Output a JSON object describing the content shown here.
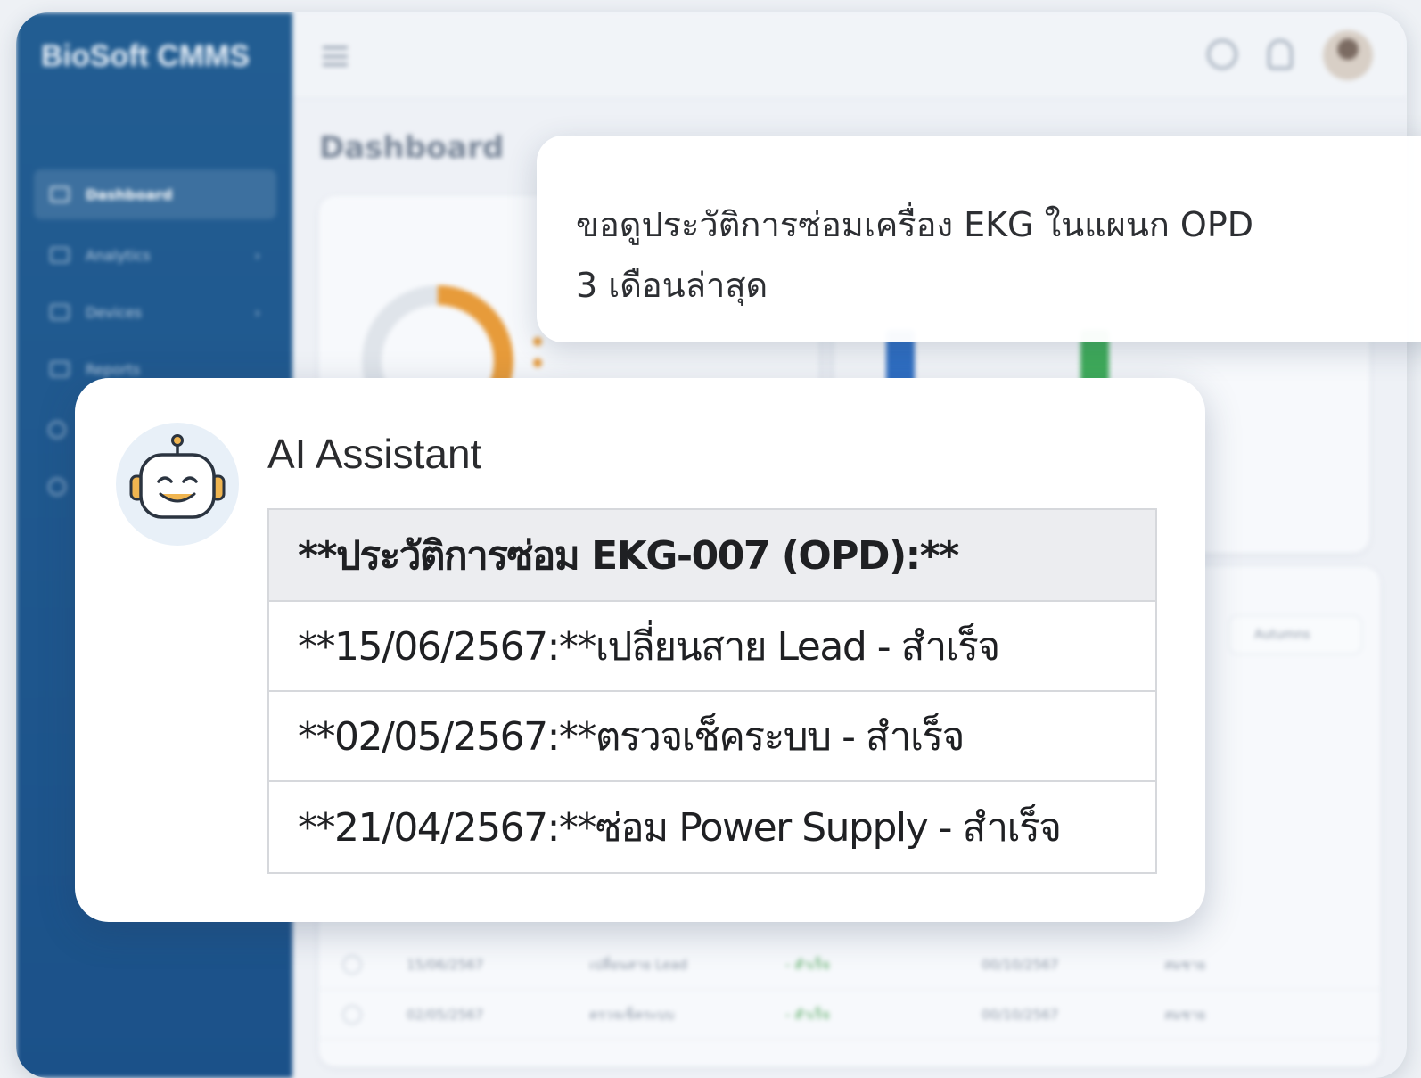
{
  "app": {
    "brand": "BioSoft CMMS",
    "page_title": "Dashboard",
    "sidebar": {
      "items": [
        {
          "label": "Dashboard",
          "active": true
        },
        {
          "label": "Analytics",
          "active": false
        },
        {
          "label": "Devices",
          "active": false
        },
        {
          "label": "Reports",
          "active": false
        }
      ]
    },
    "topbar_icons": [
      "menu-icon",
      "globe-icon",
      "bell-icon",
      "user-avatar"
    ],
    "table_filter": "Autumns",
    "background_rows": [
      {
        "date": "15/06/2567",
        "task": "เปลี่ยนสาย Lead",
        "status": "- สำเร็จ",
        "due": "00/10/2567",
        "tech": "สมชาย"
      },
      {
        "date": "02/05/2567",
        "task": "ตรวจเช็คระบบ",
        "status": "- สำเร็จ",
        "due": "00/10/2567",
        "tech": "สมชาย"
      }
    ],
    "colors": {
      "sidebar": "#225d92",
      "accent_orange": "#e79b3a",
      "accent_blue": "#2f6fc4",
      "accent_green": "#3fae5a",
      "status_green": "#53a860"
    }
  },
  "chat": {
    "user_message": "ขอดูประวัติการซ่อมเครื่อง EKG ในแผนก OPD\n3 เดือนล่าสุด",
    "assistant": {
      "name": "AI Assistant",
      "avatar_icon": "robot-icon",
      "table": {
        "header": "**ประวัติการซ่อม EKG-007 (OPD):**",
        "rows": [
          "**15/06/2567:**เปลี่ยนสาย Lead - สำเร็จ",
          "**02/05/2567:**ตรวจเช็คระบบ - สำเร็จ",
          "**21/04/2567:**ซ่อม Power Supply - สำเร็จ"
        ]
      }
    }
  }
}
